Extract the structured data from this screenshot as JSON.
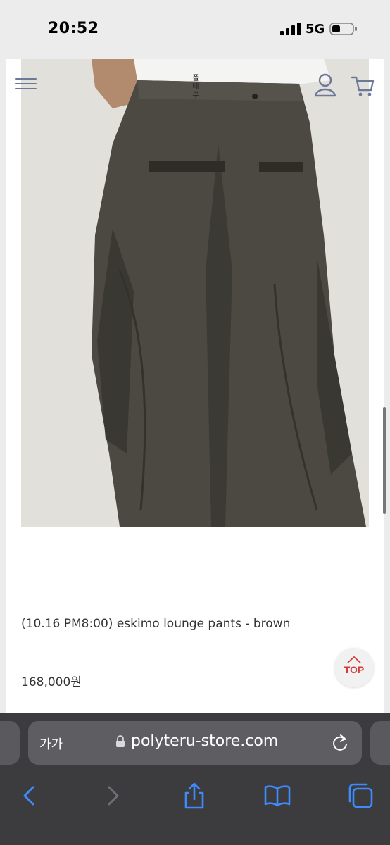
{
  "status_bar": {
    "time": "20:52",
    "network": "5G"
  },
  "site": {
    "logo_text": "폴\n테\n루",
    "product_name": "(10.16 PM8:00) eskimo lounge pants - brown",
    "price": "168,000원",
    "top_button_label": "TOP"
  },
  "browser": {
    "reader_label": "가가",
    "url": "polyteru-store.com"
  },
  "colors": {
    "accent_icon": "#6d7898",
    "top_label": "#d33a3a",
    "toolbar_active": "#3d8bff",
    "toolbar_disabled": "#6f6f74"
  },
  "icons": {
    "menu": "hamburger-icon",
    "account": "user-icon",
    "cart": "cart-icon",
    "lock": "lock-icon",
    "reload": "reload-icon",
    "back": "chevron-left-icon",
    "forward": "chevron-right-icon",
    "share": "share-icon",
    "bookmarks": "book-icon",
    "tabs": "tabs-icon"
  }
}
